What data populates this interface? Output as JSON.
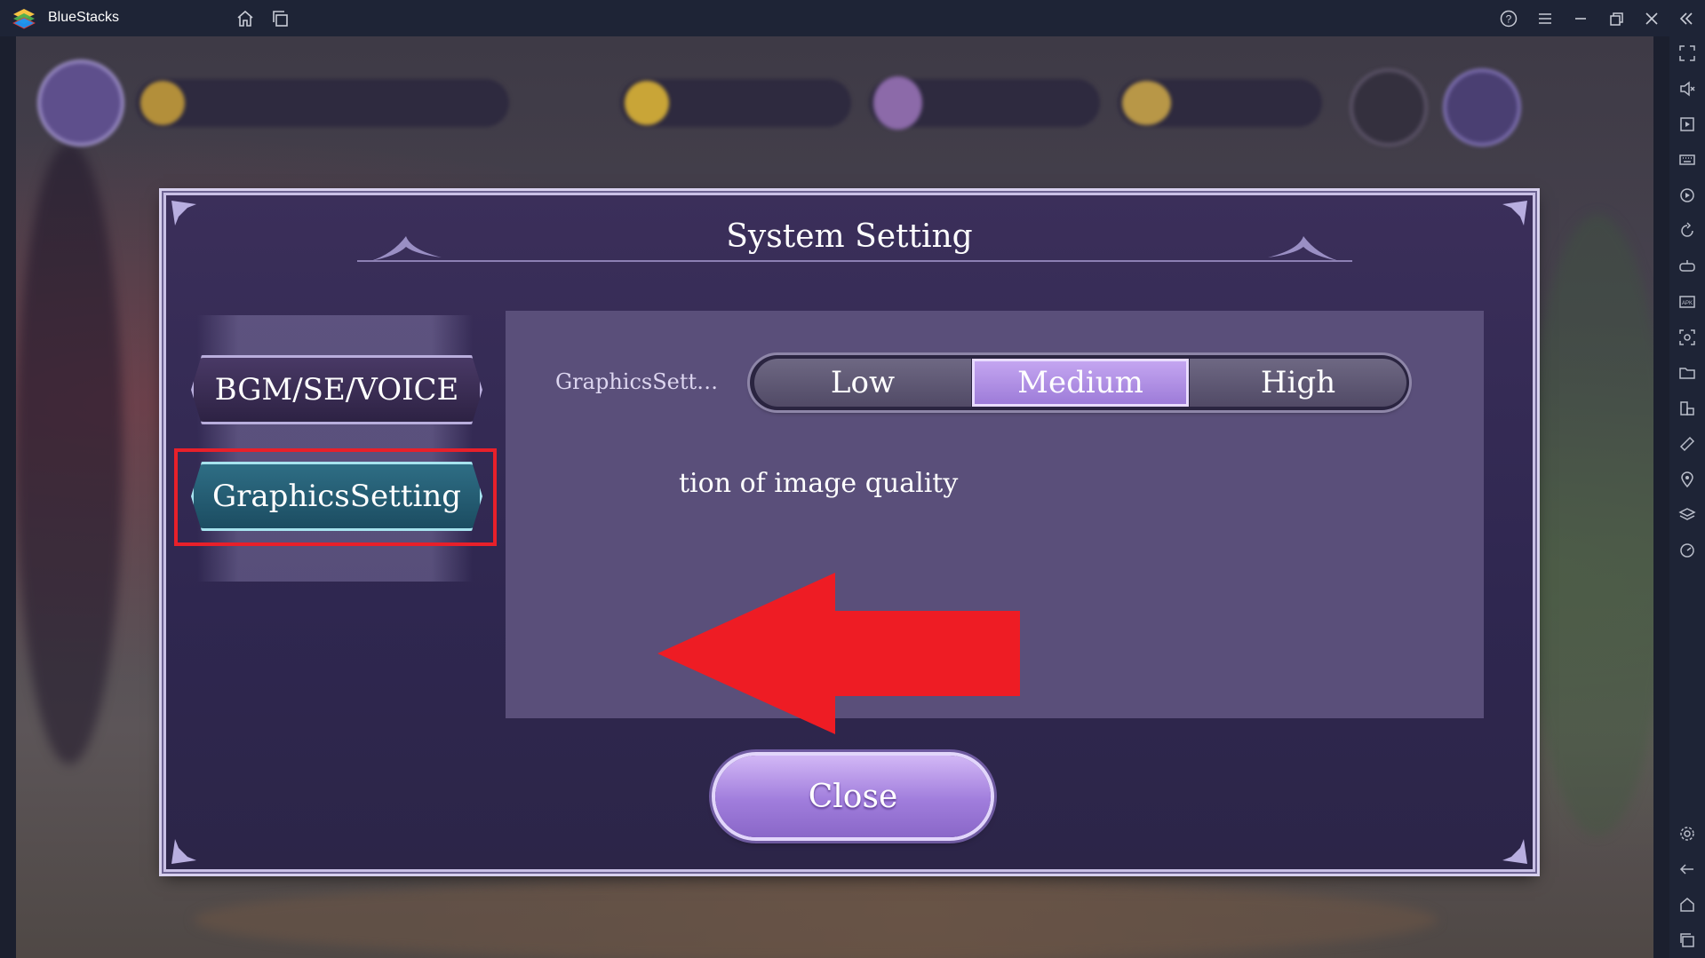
{
  "window": {
    "app_title": "BlueStacks",
    "icons": {
      "home": "home-icon",
      "multi_instance": "multi-instance-icon",
      "help": "help-icon",
      "menu": "menu-icon",
      "minimize": "minimize-icon",
      "restore": "restore-icon",
      "close": "close-icon",
      "collapse": "collapse-sidebar-icon"
    }
  },
  "sidebar": {
    "icons": [
      "fullscreen-icon",
      "volume-icon",
      "media-icon",
      "keyboard-icon",
      "macro-icon",
      "rotate-icon",
      "gamepad-icon",
      "apk-icon",
      "screenshot-icon",
      "folder-icon",
      "resize-icon",
      "eco-mode-icon",
      "location-icon",
      "layers-icon",
      "speed-icon",
      "settings-icon",
      "back-icon",
      "android-home-icon",
      "recent-apps-icon"
    ]
  },
  "dialog": {
    "title": "System Setting",
    "tabs": {
      "bgm": "BGM/SE/VOICE",
      "graphics": "GraphicsSetting"
    },
    "graphics_label": "GraphicsSett…",
    "options": {
      "low": "Low",
      "medium": "Medium",
      "high": "High"
    },
    "selected_option": "Medium",
    "description": "tion of image quality",
    "close": "Close"
  },
  "annotation": {
    "highlight_color": "#e8202a",
    "arrow_color": "#ee1c24"
  }
}
